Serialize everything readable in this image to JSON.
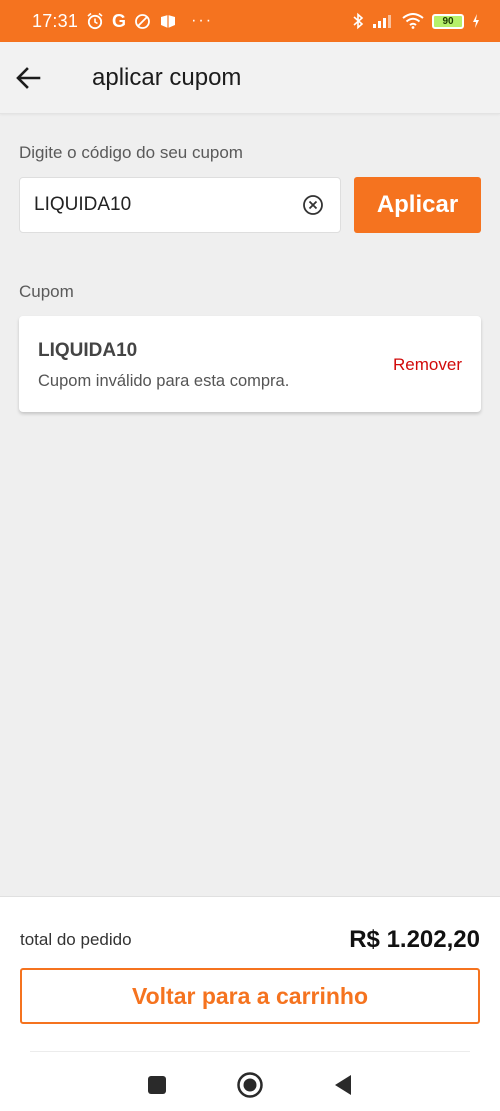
{
  "status_bar": {
    "time": "17:31",
    "g_letter": "G",
    "battery": "90",
    "more": "···",
    "icons": [
      "alarm-icon",
      "google-icon",
      "do-not-disturb-icon",
      "app-notification-icon",
      "bluetooth-icon",
      "signal-icon",
      "wifi-icon",
      "battery-icon",
      "charging-icon"
    ]
  },
  "app_bar": {
    "title": "aplicar cupom",
    "back_icon": "arrow-left-icon"
  },
  "coupon_entry": {
    "label": "Digite o código do seu cupom",
    "value": "LIQUIDA10",
    "clear_icon": "clear-circle-icon",
    "apply_label": "Aplicar"
  },
  "applied": {
    "section_label": "Cupom",
    "code": "LIQUIDA10",
    "message": "Cupom inválido para esta compra.",
    "remove_label": "Remover"
  },
  "footer": {
    "total_label": "total do pedido",
    "total_value": "R$ 1.202,20",
    "back_button_label": "Voltar para a carrinho"
  },
  "nav_bar": {
    "icons": [
      "recent-apps-icon",
      "home-icon",
      "back-icon"
    ]
  },
  "colors": {
    "accent": "#f5731f",
    "error": "#d10a0a",
    "background": "#efefef"
  }
}
